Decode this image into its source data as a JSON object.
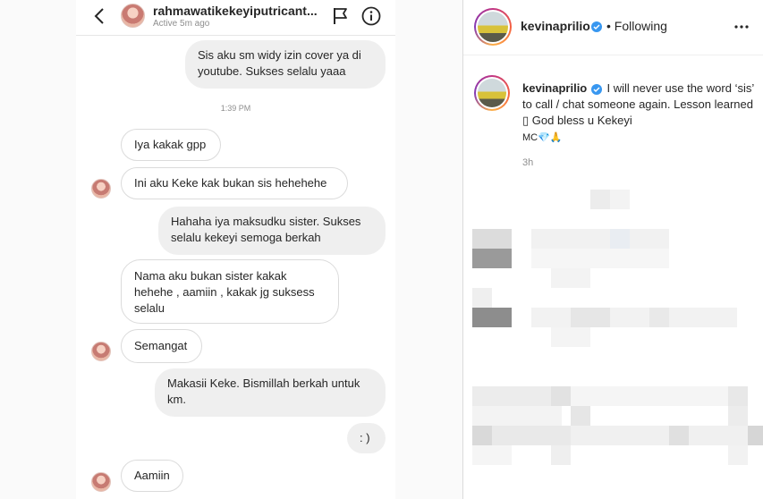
{
  "dm": {
    "title": "rahmawatikekeyiputricant...",
    "status": "Active 5m ago",
    "timestamp": "1:39 PM",
    "messages": [
      {
        "lines": [
          "Sis aku sm widy izin cover ya di",
          "youtube. Sukses selalu yaaa"
        ]
      },
      {
        "lines": [
          "Iya kakak gpp"
        ]
      },
      {
        "lines": [
          "Ini aku Keke kak bukan sis hehehehe"
        ]
      },
      {
        "lines": [
          "Hahaha iya maksudku sister. Sukses",
          "selalu kekeyi semoga berkah"
        ]
      },
      {
        "lines": [
          "Nama aku  bukan sister kakak",
          "hehehe , aamiin , kakak jg suksess",
          "selalu"
        ]
      },
      {
        "lines": [
          "Semangat"
        ]
      },
      {
        "lines": [
          "Makasii Keke. Bismillah berkah untuk",
          "km."
        ]
      },
      {
        "lines": [
          ": )"
        ]
      },
      {
        "lines": [
          "Aamiin"
        ]
      }
    ]
  },
  "post": {
    "username": "kevinaprilio",
    "follow_status": "Following",
    "separator": "•",
    "caption_handle": "kevinaprilio",
    "caption_text": "I will never use the word ‘sis’ to call / chat someone again. Lesson learned ▯ God bless u Kekeyi",
    "caption_tail": "MC💎🙏",
    "time": "3h"
  },
  "colors": {
    "verified": "#3897f0",
    "muted": "#8e8e8e",
    "bubble_out": "#efefef",
    "bubble_border": "#dbdbdb"
  }
}
